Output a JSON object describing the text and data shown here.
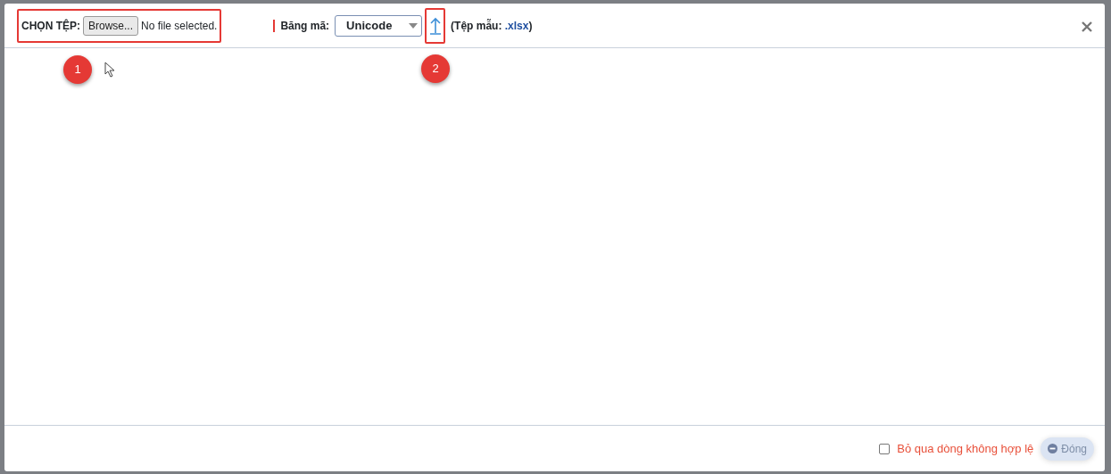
{
  "file_picker": {
    "label": "CHỌN TỆP:",
    "button": "Browse...",
    "status": "No file selected."
  },
  "encoding": {
    "label": "Băng mã:",
    "value": "Unicode"
  },
  "template": {
    "prefix": "(Tệp mẫu:",
    "link": ".xlsx",
    "suffix": ")"
  },
  "footer": {
    "skip_invalid": {
      "label": "Bỏ qua dòng không hợp lệ",
      "checked": false
    },
    "close_button": "Đóng"
  },
  "callouts": [
    {
      "number": "1"
    },
    {
      "number": "2"
    }
  ]
}
